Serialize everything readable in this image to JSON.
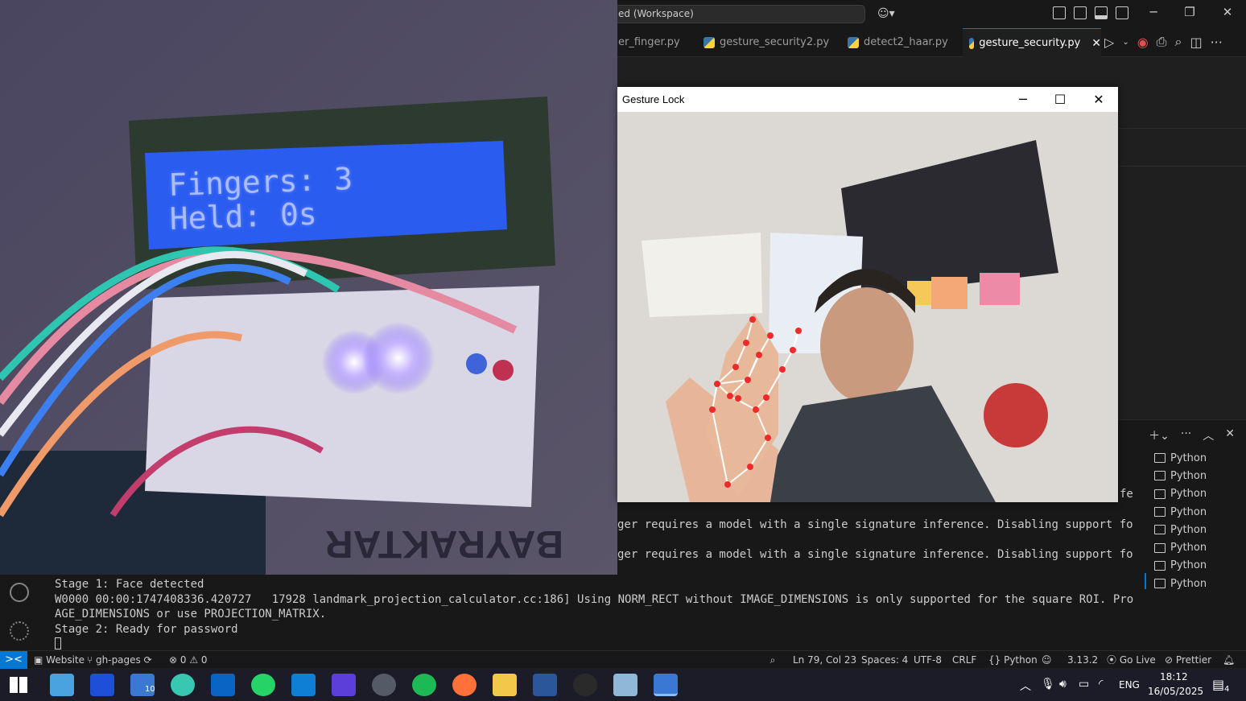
{
  "titlebar": {
    "command_center": "ed (Workspace)"
  },
  "tabs": [
    {
      "label": "er_finger.py",
      "active": false
    },
    {
      "label": "gesture_security2.py",
      "active": false
    },
    {
      "label": "detect2_haar.py",
      "active": false
    },
    {
      "label": "gesture_security.py",
      "active": true
    }
  ],
  "gesture_window": {
    "title": "Gesture Lock"
  },
  "lcd": {
    "line1": "Fingers: 3",
    "line2": "Held: 0s"
  },
  "terminal": {
    "output_right_fragment": "fe",
    "line_a": "ger requires a model with a single signature inference. Disabling support for fe",
    "line_b": "ger requires a model with a single signature inference. Disabling support for fe",
    "line1": "Stage 1: Face detected",
    "line2": "W0000 00:00:1747408336.420727   17928 landmark_projection_calculator.cc:186] Using NORM_RECT without IMAGE_DIMENSIONS is only supported for the square ROI. Provide IM",
    "line3": "AGE_DIMENSIONS or use PROJECTION_MATRIX.",
    "line4": "Stage 2: Ready for password"
  },
  "terminal_list": [
    "Python",
    "Python",
    "Python",
    "Python",
    "Python",
    "Python",
    "Python",
    "Python"
  ],
  "statusbar": {
    "remote": "><",
    "website": "Website",
    "branch": "gh-pages",
    "problems": "⊗ 0 ⚠ 0",
    "position": "Ln 79, Col 23",
    "spaces": "Spaces: 4",
    "encoding": "UTF-8",
    "eol": "CRLF",
    "language": "Python",
    "version": "3.13.2",
    "golive": "Go Live",
    "prettier": "Prettier"
  },
  "taskbar": {
    "badge_count": "10",
    "language": "ENG",
    "time": "18:12",
    "date": "16/05/2025",
    "notifications": "4"
  }
}
